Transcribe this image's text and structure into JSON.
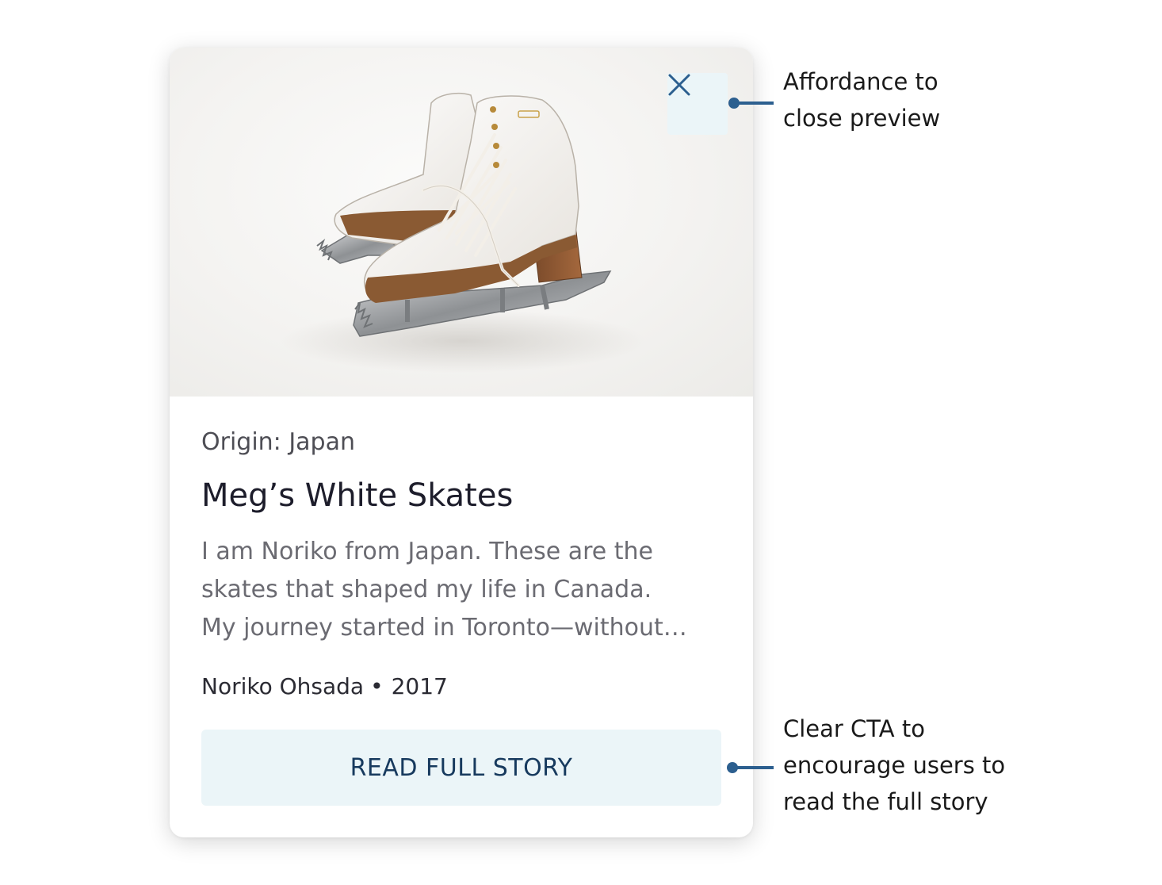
{
  "card": {
    "origin": "Origin: Japan",
    "title": "Meg’s White Skates",
    "excerpt_lines": [
      "I am Noriko from Japan. These are the",
      "skates that shaped my life in Canada.",
      "My journey started in Toronto—without…"
    ],
    "author": "Noriko Ohsada",
    "separator": "•",
    "year": "2017",
    "cta_label": "READ FULL STORY",
    "close_icon": "close-icon",
    "image": "ice-skates-photo"
  },
  "annotations": {
    "close": {
      "lines": [
        "Affordance to",
        "close preview"
      ]
    },
    "cta": {
      "lines": [
        "Clear CTA to",
        "encourage users to",
        "read the full story"
      ]
    }
  },
  "colors": {
    "accent": "#2c5f8f",
    "button_bg": "#ebf5f8",
    "cta_text": "#173a5e"
  }
}
